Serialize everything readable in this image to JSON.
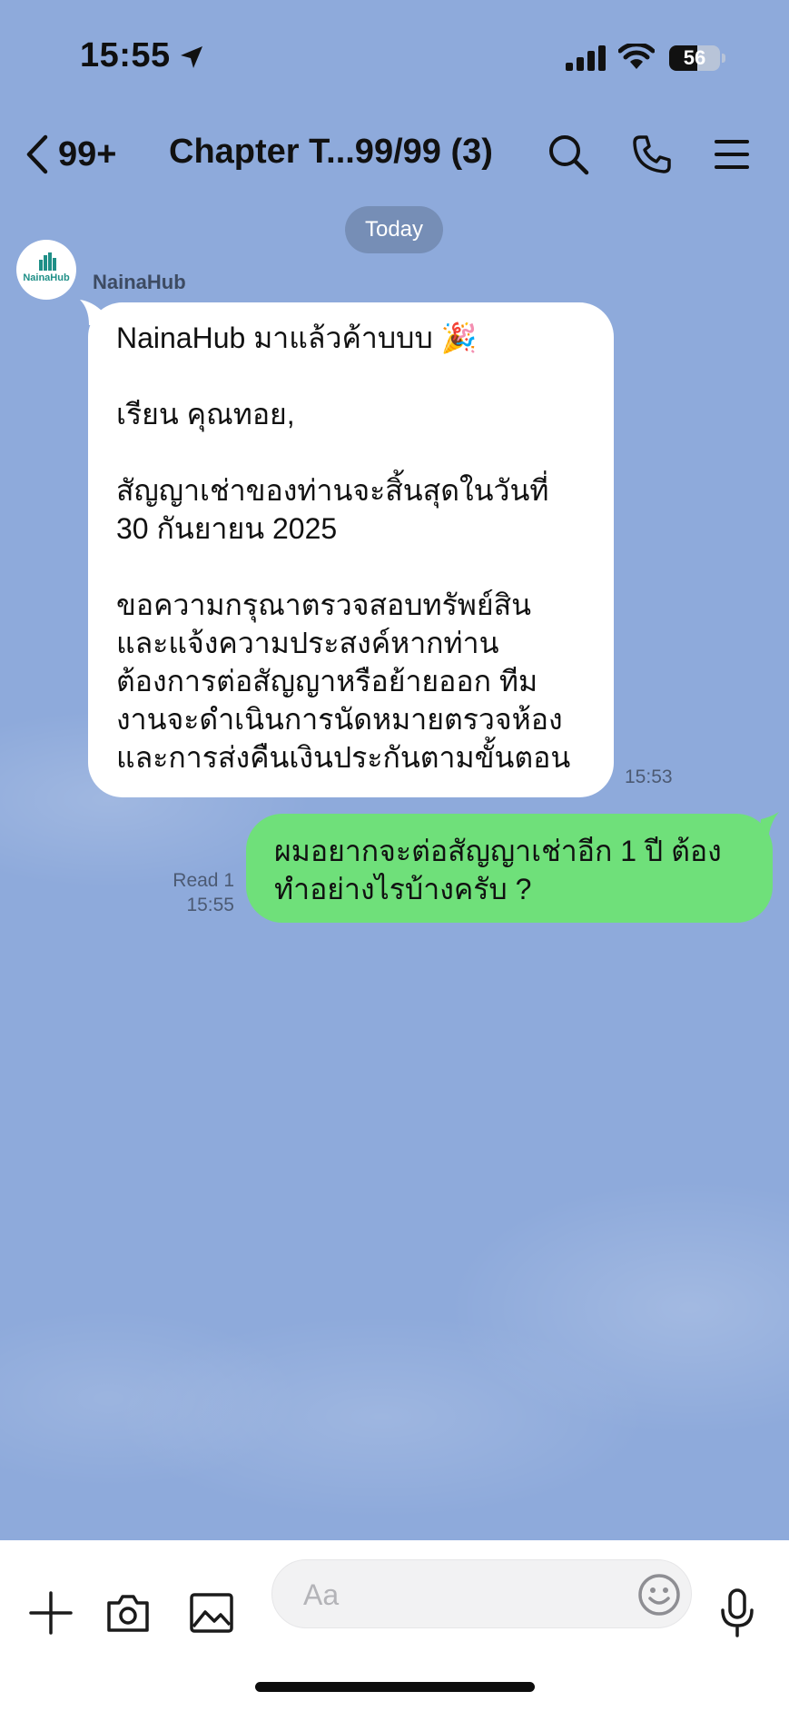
{
  "status_bar": {
    "time": "15:55",
    "battery_level": "56",
    "battery_fraction": 0.56
  },
  "header": {
    "back_count": "99+",
    "title": "Chapter T...99/99 (3)"
  },
  "date_divider": "Today",
  "messages": [
    {
      "sender": "NainaHub",
      "avatar_text": "NainaHub",
      "lines": [
        "NainaHub มาแล้วค้าบบบ 🎉",
        "",
        "เรียน คุณทอย,",
        "",
        "สัญญาเช่าของท่านจะสิ้นสุดในวันที่",
        "30 กันยายน 2025",
        "",
        "ขอความกรุณาตรวจสอบทรัพย์สิน",
        "และแจ้งความประสงค์หากท่าน",
        "ต้องการต่อสัญญาหรือย้ายออก ทีม",
        "งานจะดำเนินการนัดหมายตรวจห้อง",
        "และการส่งคืนเงินประกันตามขั้นตอน"
      ],
      "time": "15:53"
    },
    {
      "lines": [
        "ผมอยากจะต่อสัญญาเช่าอีก 1 ปี ต้อง",
        "ทำอย่างไรบ้างครับ ?"
      ],
      "read_label": "Read 1",
      "time": "15:55"
    }
  ],
  "input_bar": {
    "placeholder": "Aa"
  },
  "colors": {
    "background": "#8eaadb",
    "outgoing_bubble": "#6fe07a",
    "incoming_bubble": "#ffffff",
    "avatar_brand": "#1f8f87"
  },
  "icons": {
    "status": [
      "location-arrow-icon",
      "cellular-signal-icon",
      "wifi-icon",
      "battery-icon"
    ],
    "header": [
      "chevron-left-icon",
      "search-icon",
      "phone-icon",
      "menu-icon"
    ],
    "input_bar": [
      "plus-icon",
      "camera-icon",
      "image-icon",
      "emoji-icon",
      "microphone-icon"
    ]
  }
}
